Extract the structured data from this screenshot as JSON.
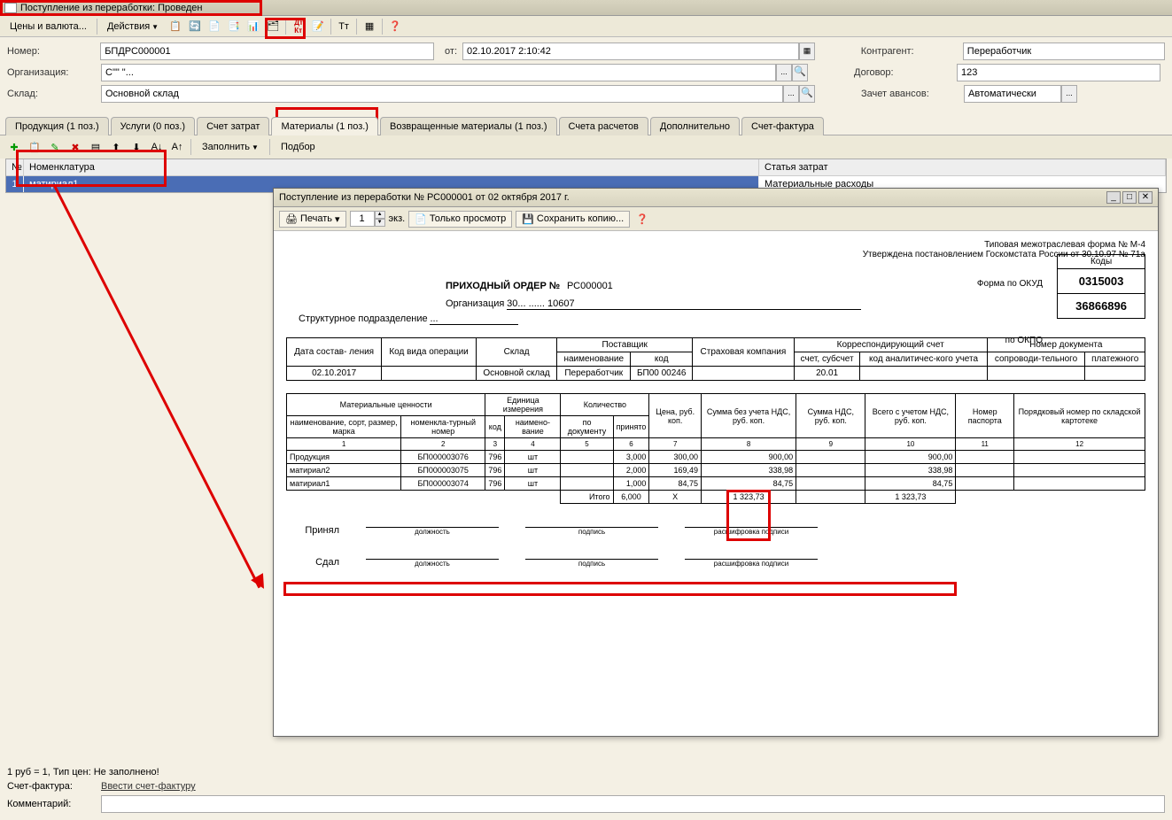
{
  "window_title": "Поступление из переработки: Проведен",
  "toolbar": {
    "prices": "Цены и валюта...",
    "actions": "Действия"
  },
  "form": {
    "num_label": "Номер:",
    "num": "БПДРС000001",
    "ot_label": "от:",
    "date": "02.10.2017 2:10:42",
    "org_label": "Организация:",
    "org": "С\"\" \"...",
    "sklad_label": "Склад:",
    "sklad": "Основной склад",
    "kontr_label": "Контрагент:",
    "kontr": "Переработчик",
    "dogovor_label": "Договор:",
    "dogovor": "123",
    "avans_label": "Зачет авансов:",
    "avans": "Автоматически"
  },
  "tabs": [
    "Продукция (1 поз.)",
    "Услуги (0 поз.)",
    "Счет затрат",
    "Материалы (1 поз.)",
    "Возвращенные материалы (1 поз.)",
    "Счета расчетов",
    "Дополнительно",
    "Счет-фактура"
  ],
  "subtoolbar": {
    "fill": "Заполнить",
    "podbor": "Подбор"
  },
  "grid": {
    "headers": {
      "n": "№",
      "nom": "Номенклатура",
      "stat": "Статья затрат"
    },
    "row": {
      "n": "1",
      "nom": "матириал1",
      "stat": "Материальные расходы"
    }
  },
  "print": {
    "title": "Поступление из переработки № РС000001 от 02 октября 2017 г.",
    "print_btn": "Печать",
    "copies": "1",
    "exz": "экз.",
    "view_only": "Только просмотр",
    "save_copy": "Сохранить копию...",
    "form_no": "Типовая межотраслевая форма № М-4",
    "approved": "Утверждена постановлением Госкомстата России от 30.10.97 № 71а",
    "codes_label": "Коды",
    "okud_label": "Форма по ОКУД",
    "okud": "0315003",
    "okpo_label": "по ОКПО",
    "okpo": "36866896",
    "doc_title": "ПРИХОДНЫЙ ОРДЕР №",
    "doc_num": "РС000001",
    "org_label": "Организация",
    "org_val": "30... ...... 10607",
    "struct_label": "Структурное подразделение",
    "struct_val": "...",
    "header_table": {
      "date": "Дата состав-\nления",
      "code": "Код вида операции",
      "sklad": "Склад",
      "supplier": "Поставщик",
      "sup_name": "наименование",
      "sup_code": "код",
      "insurance": "Страховая компания",
      "corr": "Корреспондирующий счет",
      "acc": "счет, субсчет",
      "anal": "код аналитичес-кого учета",
      "docnum": "Номер документа",
      "accomp": "сопроводи-тельного",
      "payment": "платежного",
      "r_date": "02.10.2017",
      "r_sklad": "Основной склад",
      "r_sup": "Переработчик",
      "r_code": "БП00 00246",
      "r_acc": "20.01"
    },
    "data_table": {
      "mat": "Материальные ценности",
      "name": "наименование, сорт, размер, марка",
      "nomnum": "номенкла-турный номер",
      "unit": "Единица измерения",
      "ucode": "код",
      "uname": "наимено-вание",
      "qty": "Количество",
      "qdoc": "по документу",
      "qrec": "принято",
      "price": "Цена, руб. коп.",
      "sumno": "Сумма без учета НДС, руб. коп.",
      "nds": "Сумма НДС, руб. коп.",
      "sumnds": "Всего с учетом НДС, руб. коп.",
      "passport": "Номер паспорта",
      "order": "Порядковый номер по складской картотеке",
      "rows": [
        {
          "name": "Продукция",
          "num": "БП000003076",
          "ucode": "796",
          "uname": "шт",
          "qrec": "3,000",
          "price": "300,00",
          "sumno": "900,00",
          "sumnds": "900,00"
        },
        {
          "name": "матириал2",
          "num": "БП000003075",
          "ucode": "796",
          "uname": "шт",
          "qrec": "2,000",
          "price": "169,49",
          "sumno": "338,98",
          "sumnds": "338,98"
        },
        {
          "name": "матириал1",
          "num": "БП000003074",
          "ucode": "796",
          "uname": "шт",
          "qrec": "1,000",
          "price": "84,75",
          "sumno": "84,75",
          "sumnds": "84,75"
        }
      ],
      "total": "Итого",
      "t_qrec": "6,000",
      "t_price": "X",
      "t_sumno": "1 323,73",
      "t_sumnds": "1 323,73"
    },
    "accepted": "Принял",
    "gave": "Сдал",
    "position": "должность",
    "sign": "подпись",
    "decode": "расшифровка подписи"
  },
  "footer": {
    "rate": "1 руб = 1, Тип цен: Не заполнено!",
    "sf_label": "Счет-фактура:",
    "sf_link": "Ввести счет-фактуру",
    "comment_label": "Комментарий:"
  }
}
